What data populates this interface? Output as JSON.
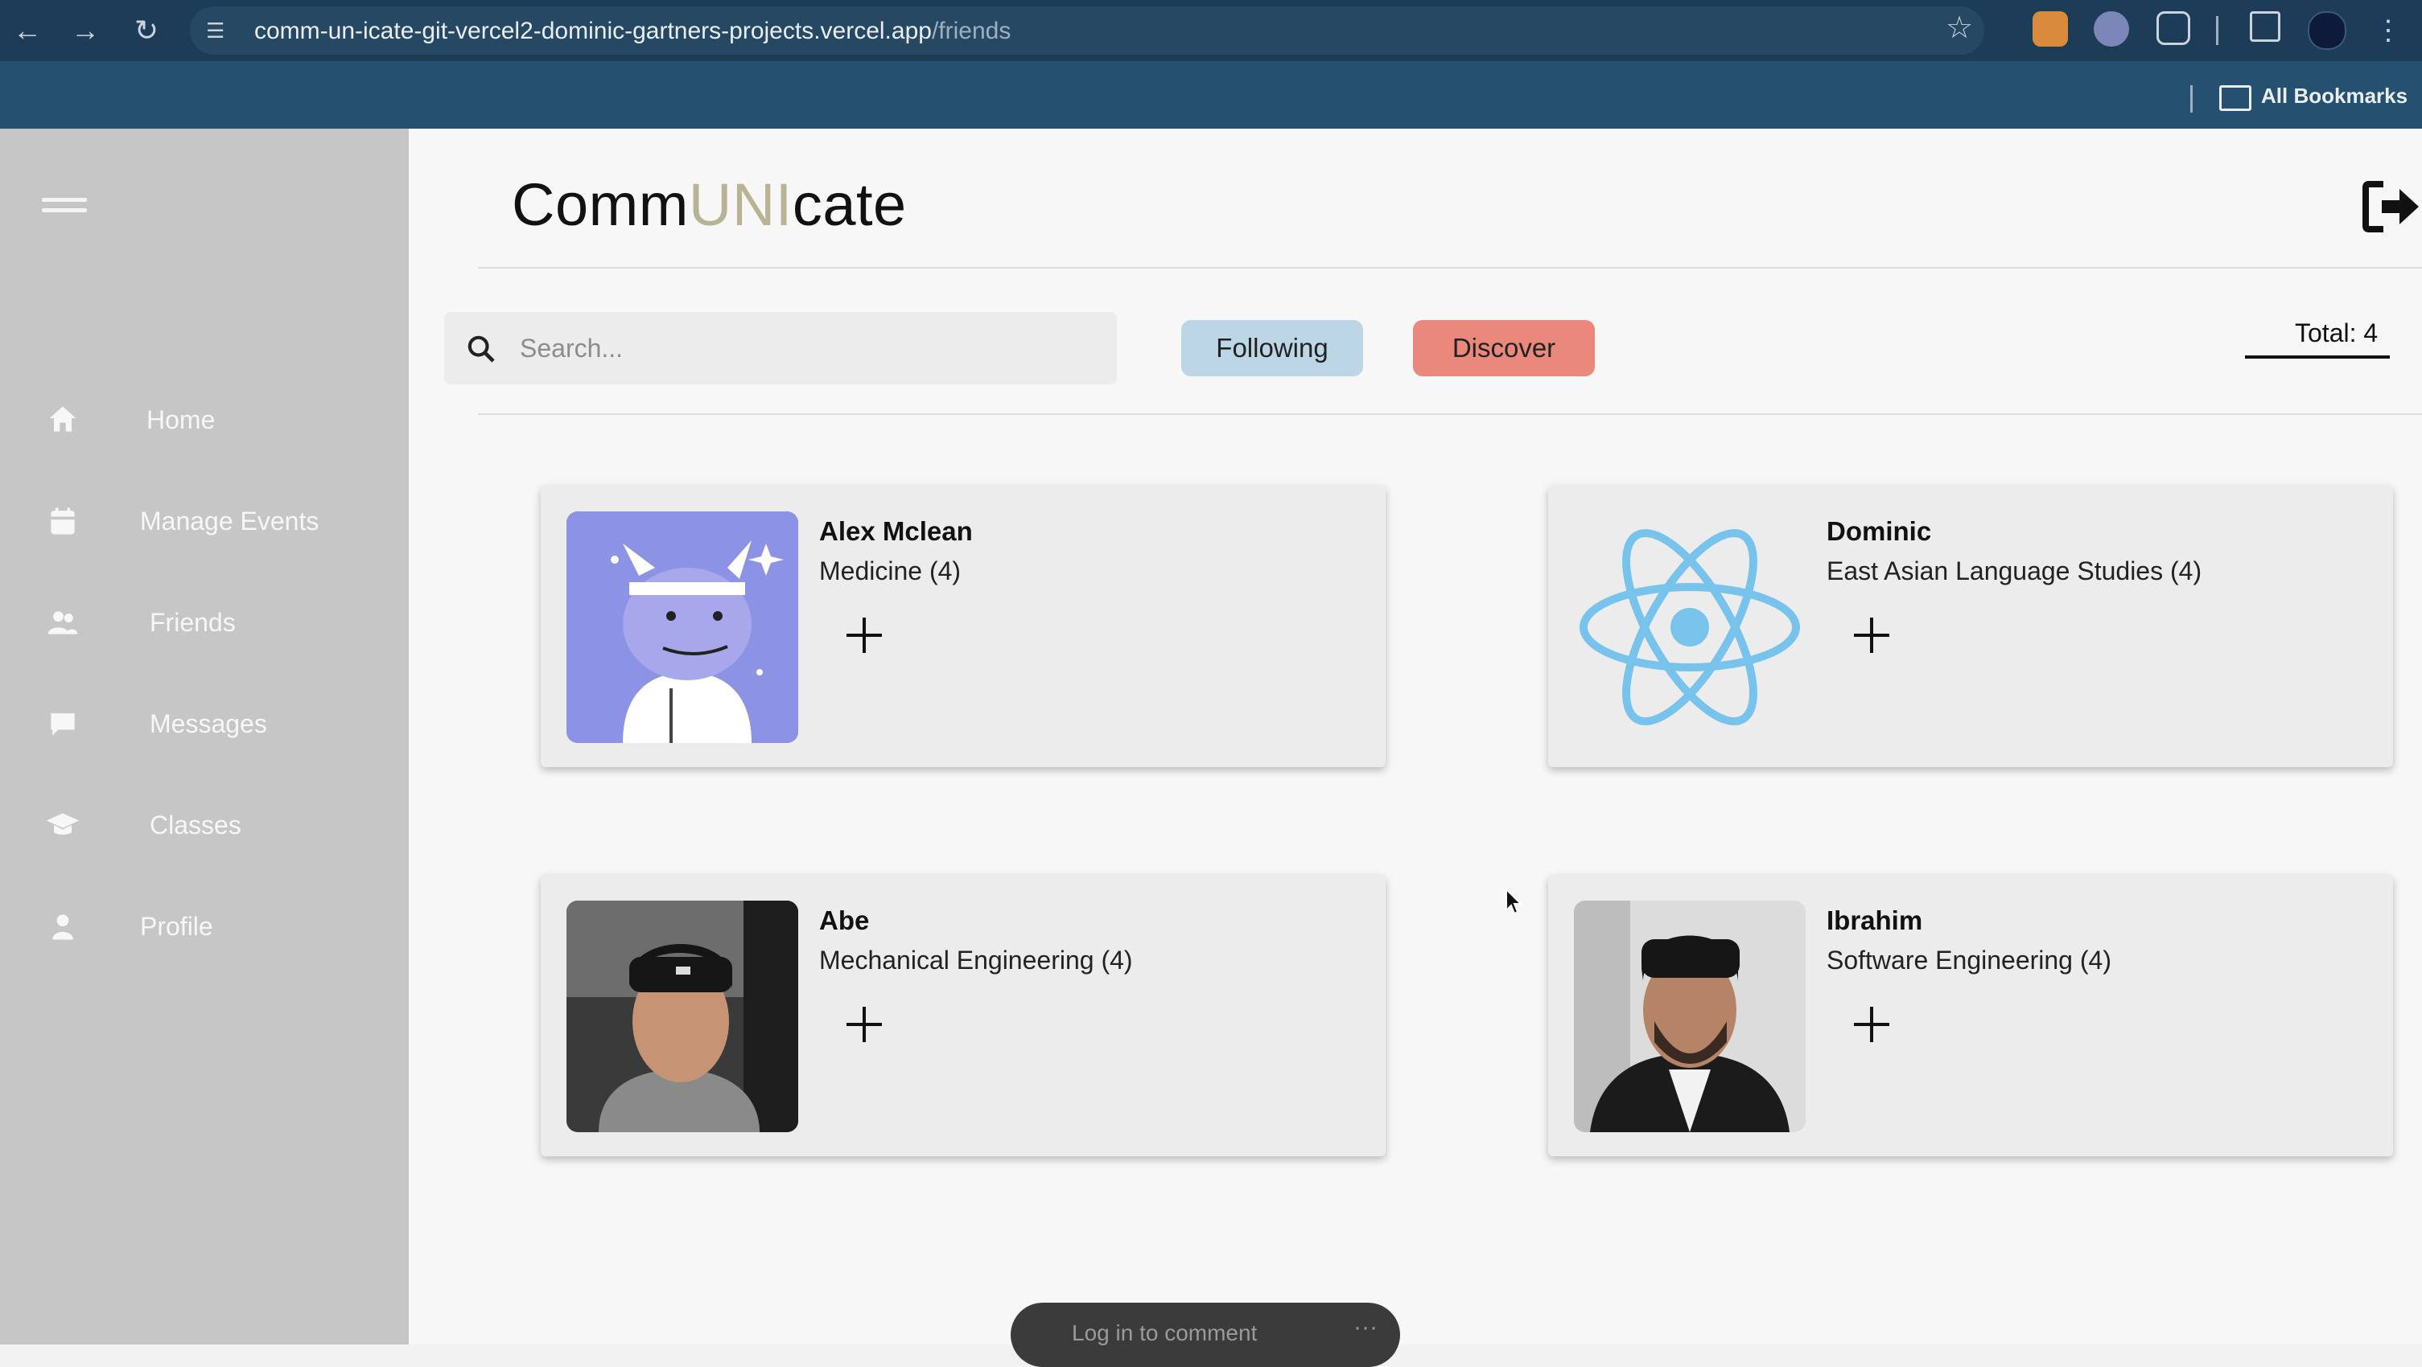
{
  "browser": {
    "url_host": "comm-un-icate-git-vercel2-dominic-gartners-projects.vercel.app",
    "url_path": "/friends",
    "bookmarks_label": "All Bookmarks",
    "icons": [
      "back-icon",
      "forward-icon",
      "reload-icon",
      "site-settings-icon",
      "bookmark-star-icon",
      "extension-icon",
      "sidebar-icon",
      "profile-icon",
      "menu-icon"
    ]
  },
  "sidebar": {
    "items": [
      {
        "label": "Home",
        "icon": "home-icon"
      },
      {
        "label": "Manage Events",
        "icon": "calendar-icon"
      },
      {
        "label": "Friends",
        "icon": "users-icon"
      },
      {
        "label": "Messages",
        "icon": "message-icon"
      },
      {
        "label": "Classes",
        "icon": "graduation-cap-icon"
      },
      {
        "label": "Profile",
        "icon": "user-icon"
      }
    ]
  },
  "header": {
    "title_prefix": "Comm",
    "title_highlight": "UNI",
    "title_suffix": "cate"
  },
  "toolbar": {
    "search_placeholder": "Search...",
    "following_label": "Following",
    "discover_label": "Discover",
    "total_label": "Total: 4"
  },
  "friends": [
    {
      "name": "Alex Mclean",
      "major": "Medicine (4)",
      "avatar": "cartoon-dragon-avatar"
    },
    {
      "name": "Dominic",
      "major": "East Asian Language Studies (4)",
      "avatar": "react-logo-avatar"
    },
    {
      "name": "Abe",
      "major": "Mechanical Engineering (4)",
      "avatar": "photo-avatar"
    },
    {
      "name": "Ibrahim",
      "major": "Software Engineering (4)",
      "avatar": "photo-avatar"
    }
  ],
  "overlay": {
    "comment_label": "Log in to comment",
    "more_label": "···"
  },
  "colors": {
    "browser_bar": "#1d3c57",
    "sidebar": "#c6c6c6",
    "following_pill": "#bcd6e6",
    "discover_pill": "#e9887b",
    "title_highlight": "#b8b394"
  }
}
